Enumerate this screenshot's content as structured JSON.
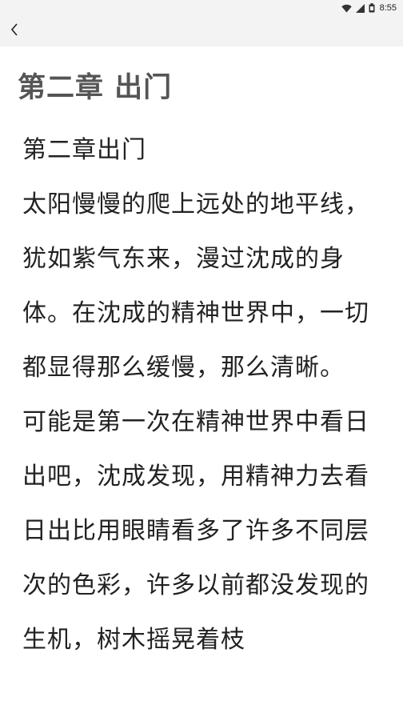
{
  "status_bar": {
    "time": "8:55",
    "icons": [
      "wifi-icon",
      "signal-icon",
      "battery-icon"
    ]
  },
  "toolbar": {
    "back_icon": "chevron-left-icon"
  },
  "chapter_title": "第二章 出门",
  "content": {
    "heading": "第二章出门",
    "paragraphs": [
      "太阳慢慢的爬上远处的地平线，犹如紫气东来，漫过沈成的身体。在沈成的精神世界中，一切都显得那么缓慢，那么清晰。",
      "可能是第一次在精神世界中看日出吧，沈成发现，用精神力去看日出比用眼睛看多了许多不同层次的色彩，许多以前都没发现的生机，树木摇晃着枝"
    ]
  }
}
